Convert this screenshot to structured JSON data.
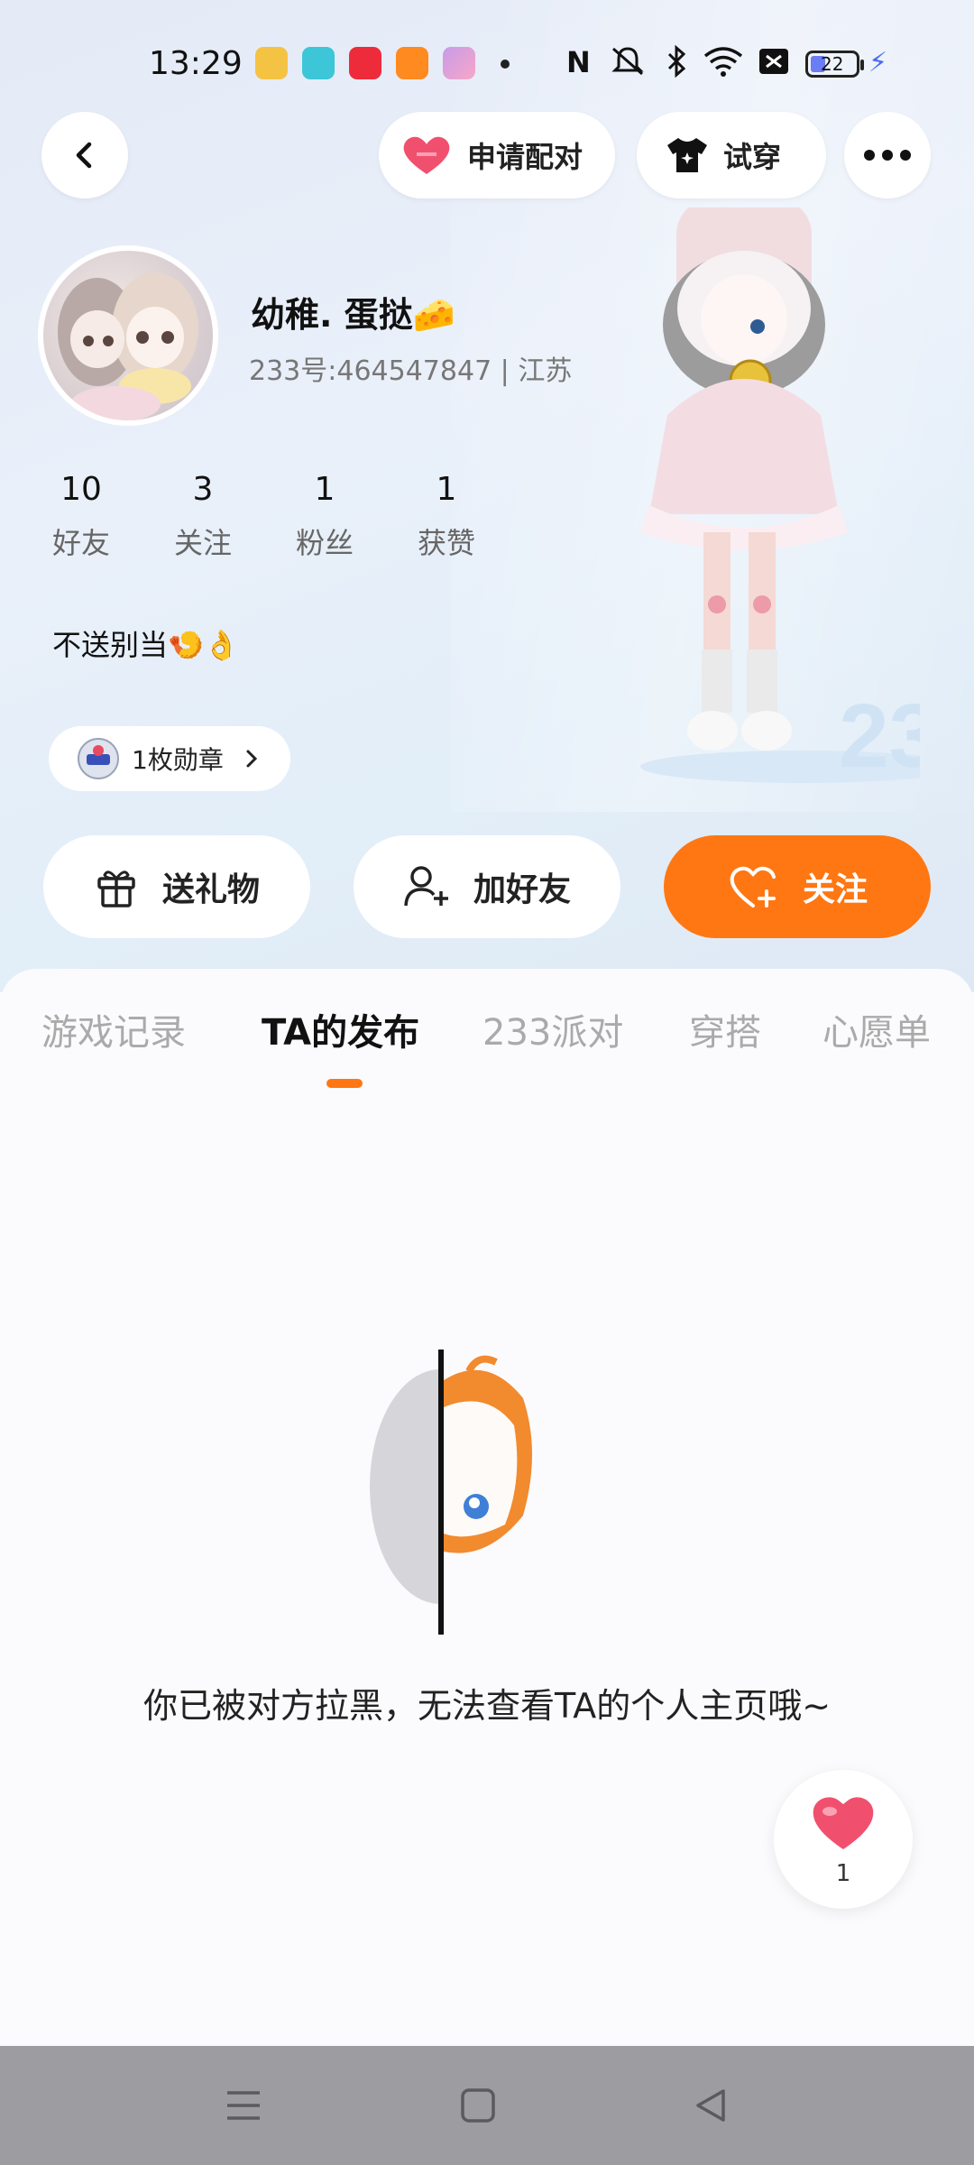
{
  "status_bar": {
    "time": "13:29",
    "battery": "22",
    "app_icons": [
      {
        "name": "weibo-icon",
        "color": "#f5c343"
      },
      {
        "name": "video-app-icon",
        "color": "#3cc6d8"
      },
      {
        "name": "xiaohongshu-icon",
        "color": "#ee2b3b"
      },
      {
        "name": "home-app-icon",
        "color": "#ff8a1f"
      },
      {
        "name": "game-app-icon",
        "color": "#c79be8"
      }
    ]
  },
  "topbar": {
    "pair_label": "申请配对",
    "tryon_label": "试穿"
  },
  "profile": {
    "nickname": "幼稚. 蛋挞🧀",
    "uid_line": "233号:464547847 | 江苏",
    "stats": [
      {
        "value": "10",
        "label": "好友"
      },
      {
        "value": "3",
        "label": "关注"
      },
      {
        "value": "1",
        "label": "粉丝"
      },
      {
        "value": "1",
        "label": "获赞"
      }
    ],
    "bio": "不送别当🍤👌",
    "badge_label": "1枚勋章"
  },
  "actions": {
    "gift": "送礼物",
    "add_friend": "加好友",
    "follow": "关注"
  },
  "tabs": [
    {
      "label": "游戏记录"
    },
    {
      "label": "TA的发布"
    },
    {
      "label": "233派对"
    },
    {
      "label": "穿搭"
    },
    {
      "label": "心愿单"
    }
  ],
  "empty_state": {
    "message": "你已被对方拉黑，无法查看TA的个人主页哦~"
  },
  "like_float": {
    "count": "1"
  },
  "colors": {
    "accent": "#ff7713",
    "heart": "#f0506e"
  }
}
